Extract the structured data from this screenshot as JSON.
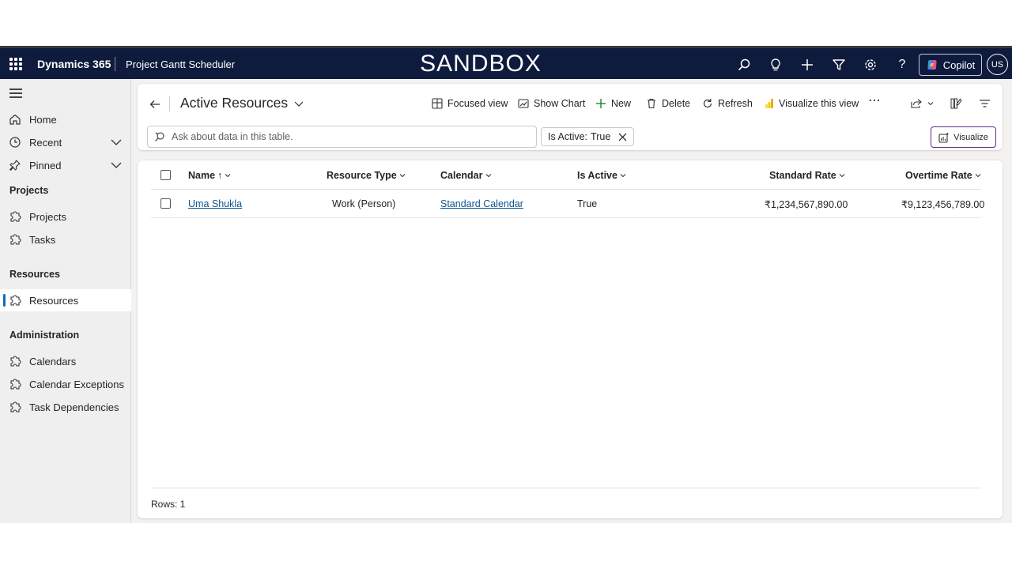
{
  "topbar": {
    "brand": "Dynamics 365",
    "app_name": "Project Gantt Scheduler",
    "environment": "SANDBOX",
    "copilot_label": "Copilot",
    "avatar_initials": "US",
    "icons": [
      "search-icon",
      "lightbulb-icon",
      "plus-icon",
      "filter-icon",
      "settings-icon",
      "help-icon"
    ]
  },
  "sidebar": {
    "top_items": [
      {
        "label": "Home",
        "icon": "home-icon"
      },
      {
        "label": "Recent",
        "icon": "clock-icon"
      },
      {
        "label": "Pinned",
        "icon": "pin-icon"
      }
    ],
    "groups": [
      {
        "title": "Projects",
        "items": [
          {
            "label": "Projects"
          },
          {
            "label": "Tasks"
          }
        ]
      },
      {
        "title": "Resources",
        "items": [
          {
            "label": "Resources",
            "selected": true
          }
        ]
      },
      {
        "title": "Administration",
        "items": [
          {
            "label": "Calendars"
          },
          {
            "label": "Calendar Exceptions"
          },
          {
            "label": "Task Dependencies"
          }
        ]
      }
    ]
  },
  "command_bar": {
    "view_title": "Active Resources",
    "commands": {
      "focused_view": "Focused view",
      "show_chart": "Show Chart",
      "new": "New",
      "delete": "Delete",
      "refresh": "Refresh",
      "visualize_view": "Visualize this view"
    },
    "ask_placeholder": "Ask about data in this table.",
    "filter_chip": {
      "label": "Is Active:",
      "value": "True"
    },
    "visualize_label": "Visualize"
  },
  "grid": {
    "columns": [
      "Name",
      "Resource Type",
      "Calendar",
      "Is Active",
      "Standard Rate",
      "Overtime Rate"
    ],
    "rows": [
      {
        "name": "Uma Shukla",
        "resource_type": "Work (Person)",
        "calendar": "Standard Calendar",
        "is_active": "True",
        "standard_rate": "₹1,234,567,890.00",
        "overtime_rate": "₹9,123,456,789.00"
      }
    ],
    "row_count_label": "Rows: 1"
  },
  "colors": {
    "topbar": "#0e1b3d",
    "accent": "#0f6cbd",
    "link": "#0f548c",
    "visualize_border": "#5c2e91"
  }
}
